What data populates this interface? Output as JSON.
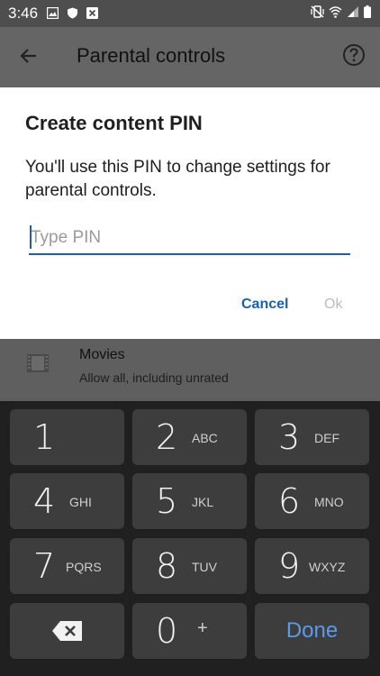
{
  "status_bar": {
    "time": "3:46"
  },
  "app_bar": {
    "title": "Parental controls",
    "back_icon": "arrow-back-icon",
    "help_icon": "help-circle-icon"
  },
  "dialog": {
    "title": "Create content PIN",
    "message": "You'll use this PIN to change settings for parental controls.",
    "pin_placeholder": "Type PIN",
    "pin_value": "",
    "cancel_label": "Cancel",
    "ok_label": "Ok"
  },
  "list_row": {
    "icon": "movie-film-icon",
    "title": "Movies",
    "subtitle": "Allow all, including unrated"
  },
  "keyboard": {
    "keys": [
      {
        "num": "1",
        "letters": ""
      },
      {
        "num": "2",
        "letters": "ABC"
      },
      {
        "num": "3",
        "letters": "DEF"
      },
      {
        "num": "4",
        "letters": "GHI"
      },
      {
        "num": "5",
        "letters": "JKL"
      },
      {
        "num": "6",
        "letters": "MNO"
      },
      {
        "num": "7",
        "letters": "PQRS"
      },
      {
        "num": "8",
        "letters": "TUV"
      },
      {
        "num": "9",
        "letters": "WXYZ"
      },
      {
        "num": "0",
        "letters": "+"
      }
    ],
    "done_label": "Done",
    "backspace_icon": "backspace-icon"
  },
  "colors": {
    "accent": "#1a5fb4",
    "disabled": "#bcbcbc",
    "done": "#5b9ae8",
    "keyboard_bg": "#202020",
    "key_bg": "#3d3d3d"
  }
}
